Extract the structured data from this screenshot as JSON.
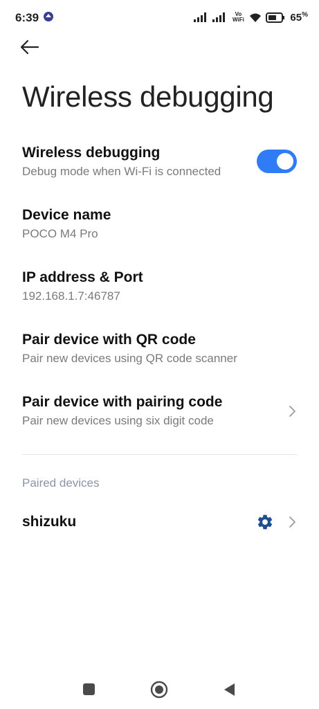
{
  "status_bar": {
    "time": "6:39",
    "vowifi_top": "Vo",
    "vowifi_bottom": "WiFi",
    "battery_value": "65",
    "battery_unit": "%"
  },
  "header": {
    "title": "Wireless debugging"
  },
  "settings": {
    "wireless_debugging": {
      "title": "Wireless debugging",
      "subtitle": "Debug mode when Wi-Fi is connected",
      "enabled": true
    },
    "device_name": {
      "title": "Device name",
      "value": "POCO M4 Pro"
    },
    "ip_address": {
      "title": "IP address & Port",
      "value": "192.168.1.7:46787"
    },
    "pair_qr": {
      "title": "Pair device with QR code",
      "subtitle": "Pair new devices using QR code scanner"
    },
    "pair_code": {
      "title": "Pair device with pairing code",
      "subtitle": "Pair new devices using six digit code"
    }
  },
  "paired_devices": {
    "header": "Paired devices",
    "items": [
      {
        "name": "shizuku"
      }
    ]
  },
  "colors": {
    "accent": "#2f7cf6",
    "gear": "#1f4f8f",
    "section_header": "#8a94a6"
  },
  "icons": {
    "back": "arrow-left-icon",
    "settings": "gear-icon",
    "chevron": "chevron-right-icon"
  }
}
